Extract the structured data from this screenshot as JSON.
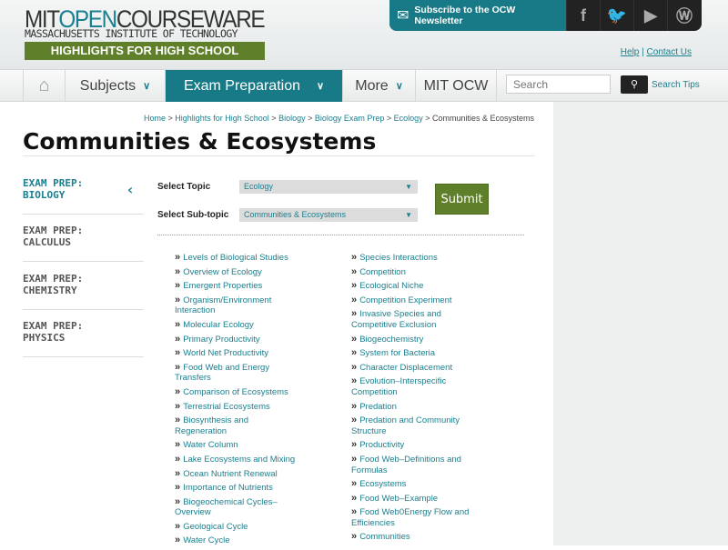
{
  "header": {
    "logo_main_a": "MIT",
    "logo_main_b": "OPEN",
    "logo_main_c": "COURSEWARE",
    "logo_sub": "MASSACHUSETTS INSTITUTE OF TECHNOLOGY",
    "banner": "HIGHLIGHTS FOR HIGH SCHOOL",
    "subscribe": "Subscribe to the OCW Newsletter",
    "social": [
      "facebook-icon",
      "twitter-icon",
      "youtube-icon",
      "wordpress-icon"
    ],
    "help": "Help",
    "sep": "|",
    "contact": "Contact Us"
  },
  "nav": {
    "subjects": "Subjects",
    "exam": "Exam Preparation",
    "more": "More",
    "mitocw": "MIT OCW",
    "search_placeholder": "Search",
    "search_tips": "Search Tips"
  },
  "breadcrumb": [
    "Home",
    "Highlights for High School",
    "Biology",
    "Biology Exam Prep",
    "Ecology",
    "Communities & Ecosystems"
  ],
  "title": "Communities & Ecosystems",
  "sidebar": [
    "EXAM PREP: BIOLOGY",
    "EXAM PREP: CALCULUS",
    "EXAM PREP: CHEMISTRY",
    "EXAM PREP: PHYSICS"
  ],
  "form": {
    "topic_label": "Select Topic",
    "topic_value": "Ecology",
    "subtopic_label": "Select Sub-topic",
    "subtopic_value": "Communities & Ecosystems",
    "submit": "Submit"
  },
  "links_left": [
    "Levels of Biological Studies",
    "Overview of Ecology",
    "Emergent Properties",
    "Organism/Environment Interaction",
    "Molecular Ecology",
    "Primary Productivity",
    "World Net Productivity",
    "Food Web and Energy Transfers",
    "Comparison of Ecosystems",
    "Terrestrial Ecosystems",
    "Biosynthesis and Regeneration",
    "Water Column",
    "Lake Ecosystems and Mixing",
    "Ocean Nutrient Renewal",
    "Importance of Nutrients",
    "Biogeochemical Cycles–Overview",
    "Geological Cycle",
    "Water Cycle"
  ],
  "links_right": [
    "Species Interactions",
    "Competition",
    "Ecological Niche",
    "Competition Experiment",
    "Invasive Species and Competitive Exclusion",
    "Biogeochemistry",
    "System for Bacteria",
    "Character Displacement",
    "Evolution–Interspecific Competition",
    "Predation",
    "Predation and Community Structure",
    "Productivity",
    "Food Web–Definitions and Formulas",
    "Ecosystems",
    "Food Web–Example",
    "Food Web0Energy Flow and Efficiencies",
    "Communities"
  ]
}
